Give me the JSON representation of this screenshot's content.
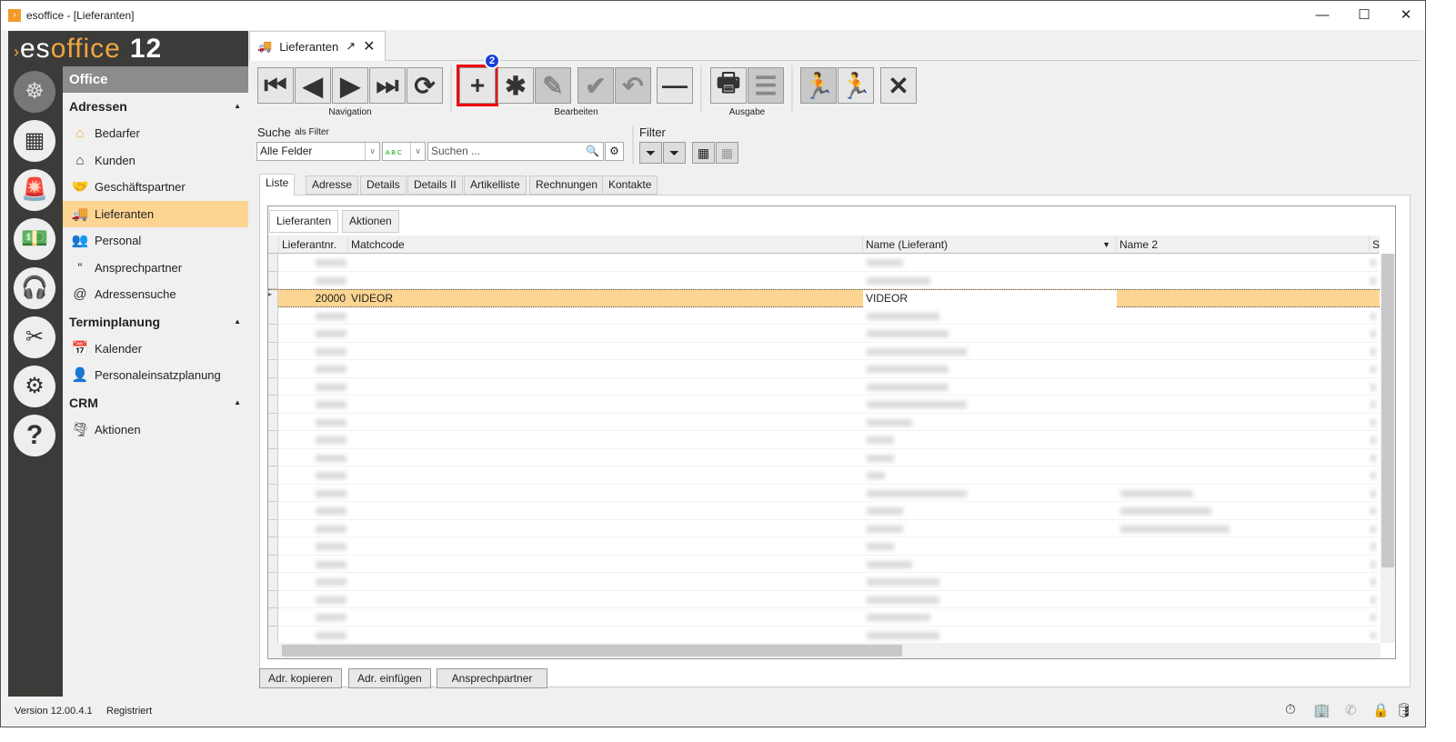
{
  "window": {
    "title": "esoffice - [Lieferanten]",
    "minimize": "—",
    "maximize": "☐",
    "close": "✕"
  },
  "logo": {
    "es": "es",
    "office": "office",
    "version": "12"
  },
  "nav": {
    "header": "Office",
    "sections": [
      {
        "title": "Adressen",
        "items": [
          {
            "label": "Bedarfer",
            "icon": "house-icon"
          },
          {
            "label": "Kunden",
            "icon": "house-icon"
          },
          {
            "label": "Geschäftspartner",
            "icon": "handshake-icon"
          },
          {
            "label": "Lieferanten",
            "icon": "truck-icon",
            "selected": true
          },
          {
            "label": "Personal",
            "icon": "people-icon"
          },
          {
            "label": "Ansprechpartner",
            "icon": "quote-icon"
          },
          {
            "label": "Adressensuche",
            "icon": "address-search-icon"
          }
        ]
      },
      {
        "title": "Terminplanung",
        "items": [
          {
            "label": "Kalender",
            "icon": "calendar-icon"
          },
          {
            "label": "Personaleinsatzplanung",
            "icon": "staff-planning-icon"
          }
        ]
      },
      {
        "title": "CRM",
        "items": [
          {
            "label": "Aktionen",
            "icon": "tornado-icon"
          }
        ]
      }
    ]
  },
  "doc_tab": {
    "label": "Lieferanten"
  },
  "toolbar": {
    "groups": {
      "navigation": "Navigation",
      "edit": "Bearbeiten",
      "output": "Ausgabe"
    },
    "badge": "2"
  },
  "search": {
    "label": "Suche",
    "filter_label": "als Filter",
    "field_select": "Alle Felder",
    "placeholder": "Suchen ...",
    "filter_title": "Filter"
  },
  "tabs": [
    "Liste",
    "Adresse",
    "Details",
    "Details II",
    "Artikelliste",
    "Rechnungen",
    "Kontakte"
  ],
  "subtabs": [
    "Lieferanten",
    "Aktionen"
  ],
  "grid": {
    "columns": [
      "Lieferantnr.",
      "Matchcode",
      "Name (Lieferant)",
      "Name 2",
      "S"
    ],
    "selected_row": {
      "nr": "20000",
      "matchcode": "VIDEOR",
      "name": "VIDEOR",
      "name2": ""
    }
  },
  "bottom_buttons": [
    "Adr. kopieren",
    "Adr. einfügen",
    "Ansprechpartner"
  ],
  "status": {
    "version": "Version 12.00.4.1",
    "registered": "Registriert"
  },
  "colors": {
    "accent": "#fdd592",
    "sidebar_dark": "#3b3b39",
    "logo_orange": "#f2a640",
    "highlight": "#e00000",
    "badge": "#1a3ed8"
  }
}
